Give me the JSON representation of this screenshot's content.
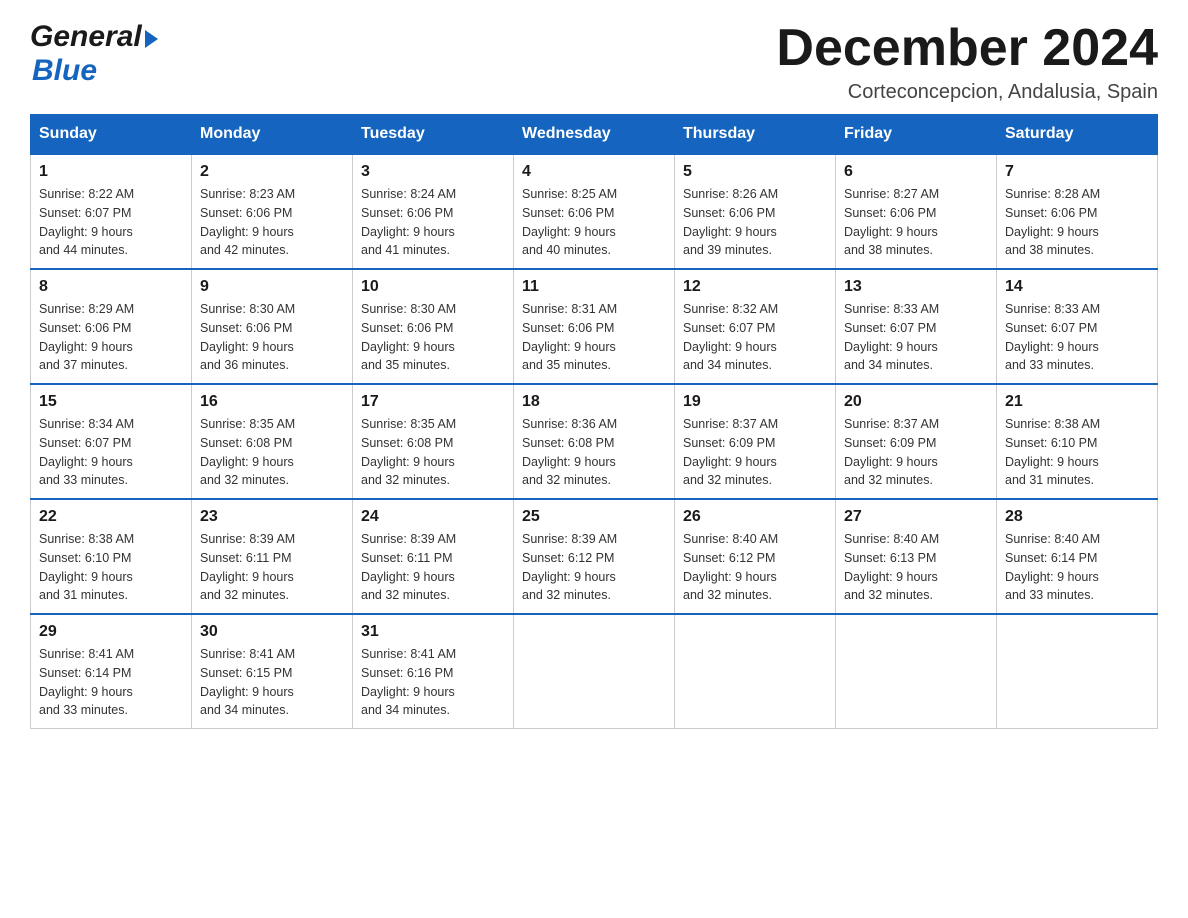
{
  "header": {
    "logo_general": "General",
    "logo_blue": "Blue",
    "month_title": "December 2024",
    "subtitle": "Corteconcepcion, Andalusia, Spain"
  },
  "days_of_week": [
    "Sunday",
    "Monday",
    "Tuesday",
    "Wednesday",
    "Thursday",
    "Friday",
    "Saturday"
  ],
  "weeks": [
    [
      {
        "num": "1",
        "sunrise": "8:22 AM",
        "sunset": "6:07 PM",
        "daylight": "9 hours and 44 minutes."
      },
      {
        "num": "2",
        "sunrise": "8:23 AM",
        "sunset": "6:06 PM",
        "daylight": "9 hours and 42 minutes."
      },
      {
        "num": "3",
        "sunrise": "8:24 AM",
        "sunset": "6:06 PM",
        "daylight": "9 hours and 41 minutes."
      },
      {
        "num": "4",
        "sunrise": "8:25 AM",
        "sunset": "6:06 PM",
        "daylight": "9 hours and 40 minutes."
      },
      {
        "num": "5",
        "sunrise": "8:26 AM",
        "sunset": "6:06 PM",
        "daylight": "9 hours and 39 minutes."
      },
      {
        "num": "6",
        "sunrise": "8:27 AM",
        "sunset": "6:06 PM",
        "daylight": "9 hours and 38 minutes."
      },
      {
        "num": "7",
        "sunrise": "8:28 AM",
        "sunset": "6:06 PM",
        "daylight": "9 hours and 38 minutes."
      }
    ],
    [
      {
        "num": "8",
        "sunrise": "8:29 AM",
        "sunset": "6:06 PM",
        "daylight": "9 hours and 37 minutes."
      },
      {
        "num": "9",
        "sunrise": "8:30 AM",
        "sunset": "6:06 PM",
        "daylight": "9 hours and 36 minutes."
      },
      {
        "num": "10",
        "sunrise": "8:30 AM",
        "sunset": "6:06 PM",
        "daylight": "9 hours and 35 minutes."
      },
      {
        "num": "11",
        "sunrise": "8:31 AM",
        "sunset": "6:06 PM",
        "daylight": "9 hours and 35 minutes."
      },
      {
        "num": "12",
        "sunrise": "8:32 AM",
        "sunset": "6:07 PM",
        "daylight": "9 hours and 34 minutes."
      },
      {
        "num": "13",
        "sunrise": "8:33 AM",
        "sunset": "6:07 PM",
        "daylight": "9 hours and 34 minutes."
      },
      {
        "num": "14",
        "sunrise": "8:33 AM",
        "sunset": "6:07 PM",
        "daylight": "9 hours and 33 minutes."
      }
    ],
    [
      {
        "num": "15",
        "sunrise": "8:34 AM",
        "sunset": "6:07 PM",
        "daylight": "9 hours and 33 minutes."
      },
      {
        "num": "16",
        "sunrise": "8:35 AM",
        "sunset": "6:08 PM",
        "daylight": "9 hours and 32 minutes."
      },
      {
        "num": "17",
        "sunrise": "8:35 AM",
        "sunset": "6:08 PM",
        "daylight": "9 hours and 32 minutes."
      },
      {
        "num": "18",
        "sunrise": "8:36 AM",
        "sunset": "6:08 PM",
        "daylight": "9 hours and 32 minutes."
      },
      {
        "num": "19",
        "sunrise": "8:37 AM",
        "sunset": "6:09 PM",
        "daylight": "9 hours and 32 minutes."
      },
      {
        "num": "20",
        "sunrise": "8:37 AM",
        "sunset": "6:09 PM",
        "daylight": "9 hours and 32 minutes."
      },
      {
        "num": "21",
        "sunrise": "8:38 AM",
        "sunset": "6:10 PM",
        "daylight": "9 hours and 31 minutes."
      }
    ],
    [
      {
        "num": "22",
        "sunrise": "8:38 AM",
        "sunset": "6:10 PM",
        "daylight": "9 hours and 31 minutes."
      },
      {
        "num": "23",
        "sunrise": "8:39 AM",
        "sunset": "6:11 PM",
        "daylight": "9 hours and 32 minutes."
      },
      {
        "num": "24",
        "sunrise": "8:39 AM",
        "sunset": "6:11 PM",
        "daylight": "9 hours and 32 minutes."
      },
      {
        "num": "25",
        "sunrise": "8:39 AM",
        "sunset": "6:12 PM",
        "daylight": "9 hours and 32 minutes."
      },
      {
        "num": "26",
        "sunrise": "8:40 AM",
        "sunset": "6:12 PM",
        "daylight": "9 hours and 32 minutes."
      },
      {
        "num": "27",
        "sunrise": "8:40 AM",
        "sunset": "6:13 PM",
        "daylight": "9 hours and 32 minutes."
      },
      {
        "num": "28",
        "sunrise": "8:40 AM",
        "sunset": "6:14 PM",
        "daylight": "9 hours and 33 minutes."
      }
    ],
    [
      {
        "num": "29",
        "sunrise": "8:41 AM",
        "sunset": "6:14 PM",
        "daylight": "9 hours and 33 minutes."
      },
      {
        "num": "30",
        "sunrise": "8:41 AM",
        "sunset": "6:15 PM",
        "daylight": "9 hours and 34 minutes."
      },
      {
        "num": "31",
        "sunrise": "8:41 AM",
        "sunset": "6:16 PM",
        "daylight": "9 hours and 34 minutes."
      },
      null,
      null,
      null,
      null
    ]
  ],
  "labels": {
    "sunrise": "Sunrise:",
    "sunset": "Sunset:",
    "daylight": "Daylight:"
  }
}
